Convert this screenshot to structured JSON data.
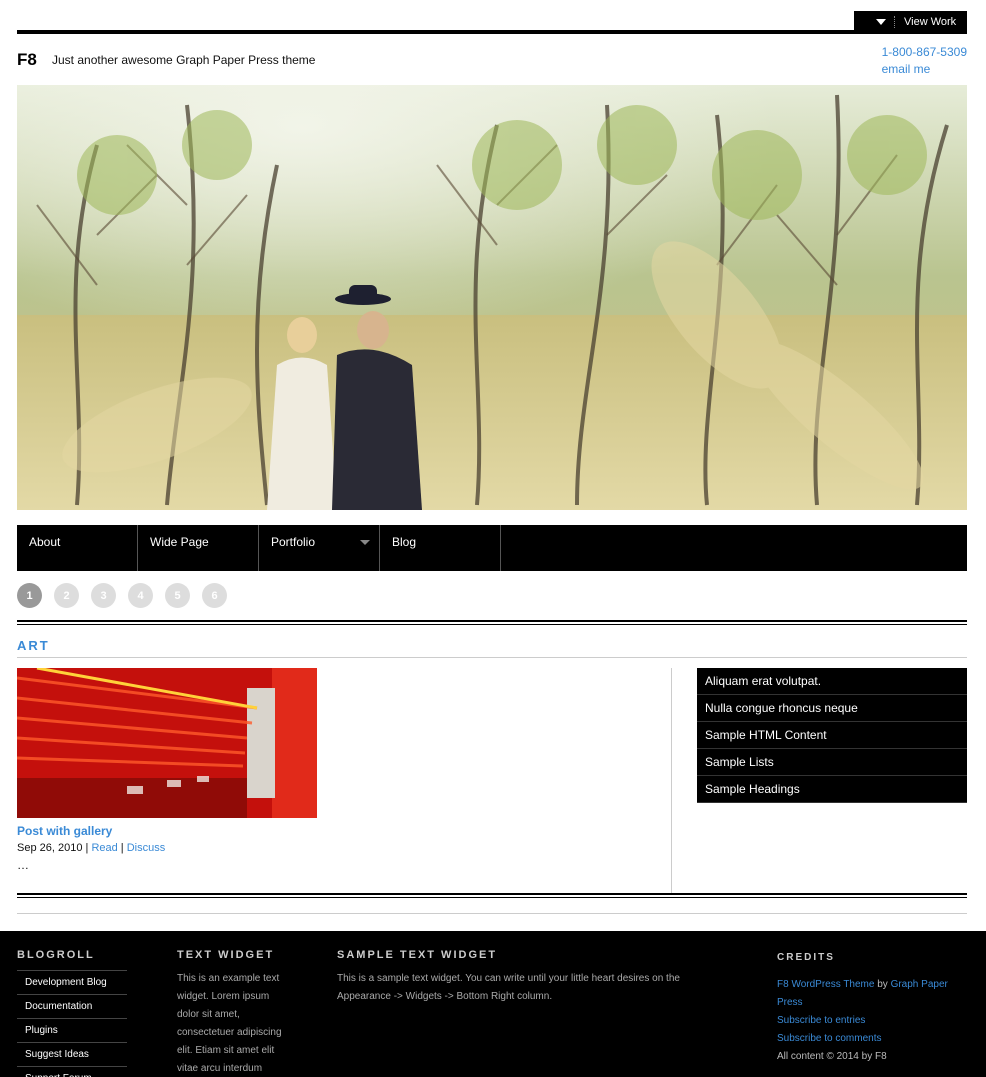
{
  "topbar": {
    "view_work_label": "View Work"
  },
  "header": {
    "site_title": "F8",
    "tagline": "Just another awesome Graph Paper Press theme",
    "phone": "1-800-867-5309",
    "email_label": "email me"
  },
  "nav": {
    "items": [
      {
        "label": "About"
      },
      {
        "label": "Wide Page"
      },
      {
        "label": "Portfolio"
      },
      {
        "label": "Blog"
      }
    ]
  },
  "pager": {
    "pages": [
      "1",
      "2",
      "3",
      "4",
      "5",
      "6"
    ],
    "active": "1"
  },
  "section": {
    "title": "ART"
  },
  "post": {
    "title": "Post with gallery",
    "date": "Sep 26, 2010",
    "read_label": "Read",
    "discuss_label": "Discuss",
    "separator": "|",
    "excerpt": "…"
  },
  "sidebar": {
    "items": [
      {
        "label": "Aliquam erat volutpat."
      },
      {
        "label": "Nulla congue rhoncus neque"
      },
      {
        "label": "Sample HTML Content"
      },
      {
        "label": "Sample Lists"
      },
      {
        "label": "Sample Headings"
      }
    ]
  },
  "footer": {
    "blogroll": {
      "heading": "BLOGROLL",
      "items": [
        {
          "label": "Development Blog"
        },
        {
          "label": "Documentation"
        },
        {
          "label": "Plugins"
        },
        {
          "label": "Suggest Ideas"
        },
        {
          "label": "Support Forum"
        }
      ]
    },
    "text_widget": {
      "heading": "TEXT WIDGET",
      "body": "This is an example text widget. Lorem ipsum dolor sit amet, consectetuer adipiscing elit. Etiam sit amet elit vitae arcu interdum"
    },
    "sample_widget": {
      "heading": "SAMPLE TEXT WIDGET",
      "body": "This is a sample text widget. You can write until your little heart desires on the Appearance -> Widgets -> Bottom Right column."
    },
    "credits": {
      "heading": "CREDITS",
      "theme_link": "F8 WordPress Theme",
      "by": "by",
      "author_link": "Graph Paper Press",
      "subscribe_entries": "Subscribe to entries",
      "subscribe_comments": "Subscribe to comments",
      "copyright": "All content © 2014 by F8"
    }
  },
  "colors": {
    "accent": "#3a8ad6",
    "nav_bg": "#000000",
    "footer_bg": "#000000"
  }
}
